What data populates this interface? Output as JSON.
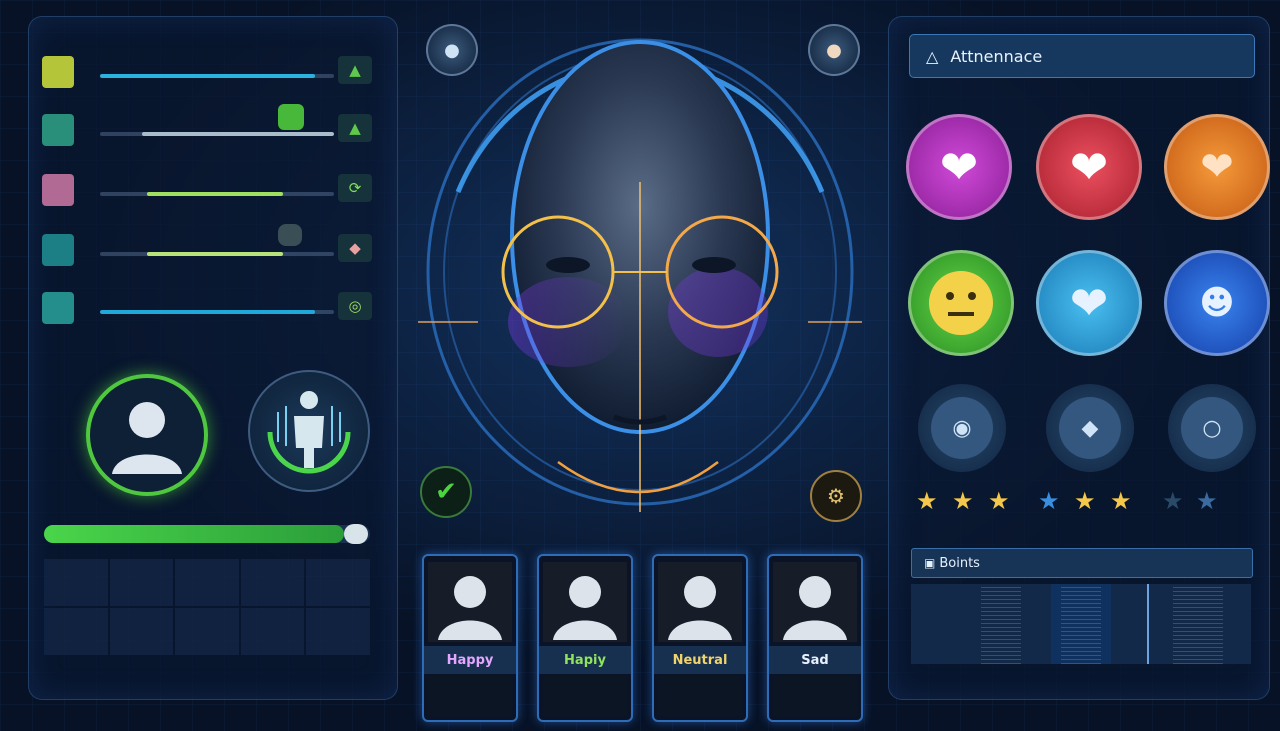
{
  "colors": {
    "accent_blue": "#3b8fe6",
    "green": "#46c93c",
    "panel_bg": "#0a1830"
  },
  "left_panel": {
    "metrics": [
      {
        "icon": "leaf-icon",
        "icon_color": "#b5c53a",
        "level": 0.92,
        "fill_color": "#2bb3e0",
        "action_icon": "sprout-icon"
      },
      {
        "icon": "book-icon",
        "icon_color": "#2a8f7a",
        "level": 0.82,
        "fill_color": "#a8bdc9",
        "action_icon": "sprout-icon"
      },
      {
        "icon": "timer-icon",
        "icon_color": "#b06a93",
        "level": 0.58,
        "fill_color": "#9fe060",
        "action_icon": "spiral-icon"
      },
      {
        "icon": "bottle-icon",
        "icon_color": "#1d7f86",
        "level": 0.58,
        "fill_color": "#b7e37a",
        "action_icon": "gem-icon"
      },
      {
        "icon": "chat-icon",
        "icon_color": "#238e8c",
        "level": 0.92,
        "fill_color": "#1fa8d8",
        "action_icon": "target-icon"
      }
    ],
    "progress": 0.92
  },
  "center": {
    "emotion_cards": [
      {
        "label": "Happy",
        "color": "#e3a7ff"
      },
      {
        "label": "Hapiy",
        "color": "#8fe35d"
      },
      {
        "label": "Neutral",
        "color": "#f0d36b"
      },
      {
        "label": "Sad",
        "color": "#e8f0ff"
      }
    ]
  },
  "right_panel": {
    "attendance_title": "Attnennace",
    "points_title": "Boints",
    "reactions": [
      {
        "name": "heart-icon",
        "color": "#b62fc0"
      },
      {
        "name": "heart-icon",
        "color": "#d83a4a"
      },
      {
        "name": "heart-icon",
        "color": "#f0802a"
      },
      {
        "name": "neutral-face-icon",
        "color": "#4eba3c"
      },
      {
        "name": "heart-icon",
        "color": "#2aa2d6"
      },
      {
        "name": "person-icon",
        "color": "#2b6ad6"
      }
    ],
    "stars": [
      {
        "color": "#f5c84a"
      },
      {
        "color": "#f5c84a"
      },
      {
        "color": "#f5c84a"
      },
      {
        "color": "#3a8ee0"
      },
      {
        "color": "#f5c84a"
      },
      {
        "color": "#f5c84a"
      },
      {
        "color": "#2a4a6a"
      },
      {
        "color": "#3b6aa0"
      }
    ]
  }
}
